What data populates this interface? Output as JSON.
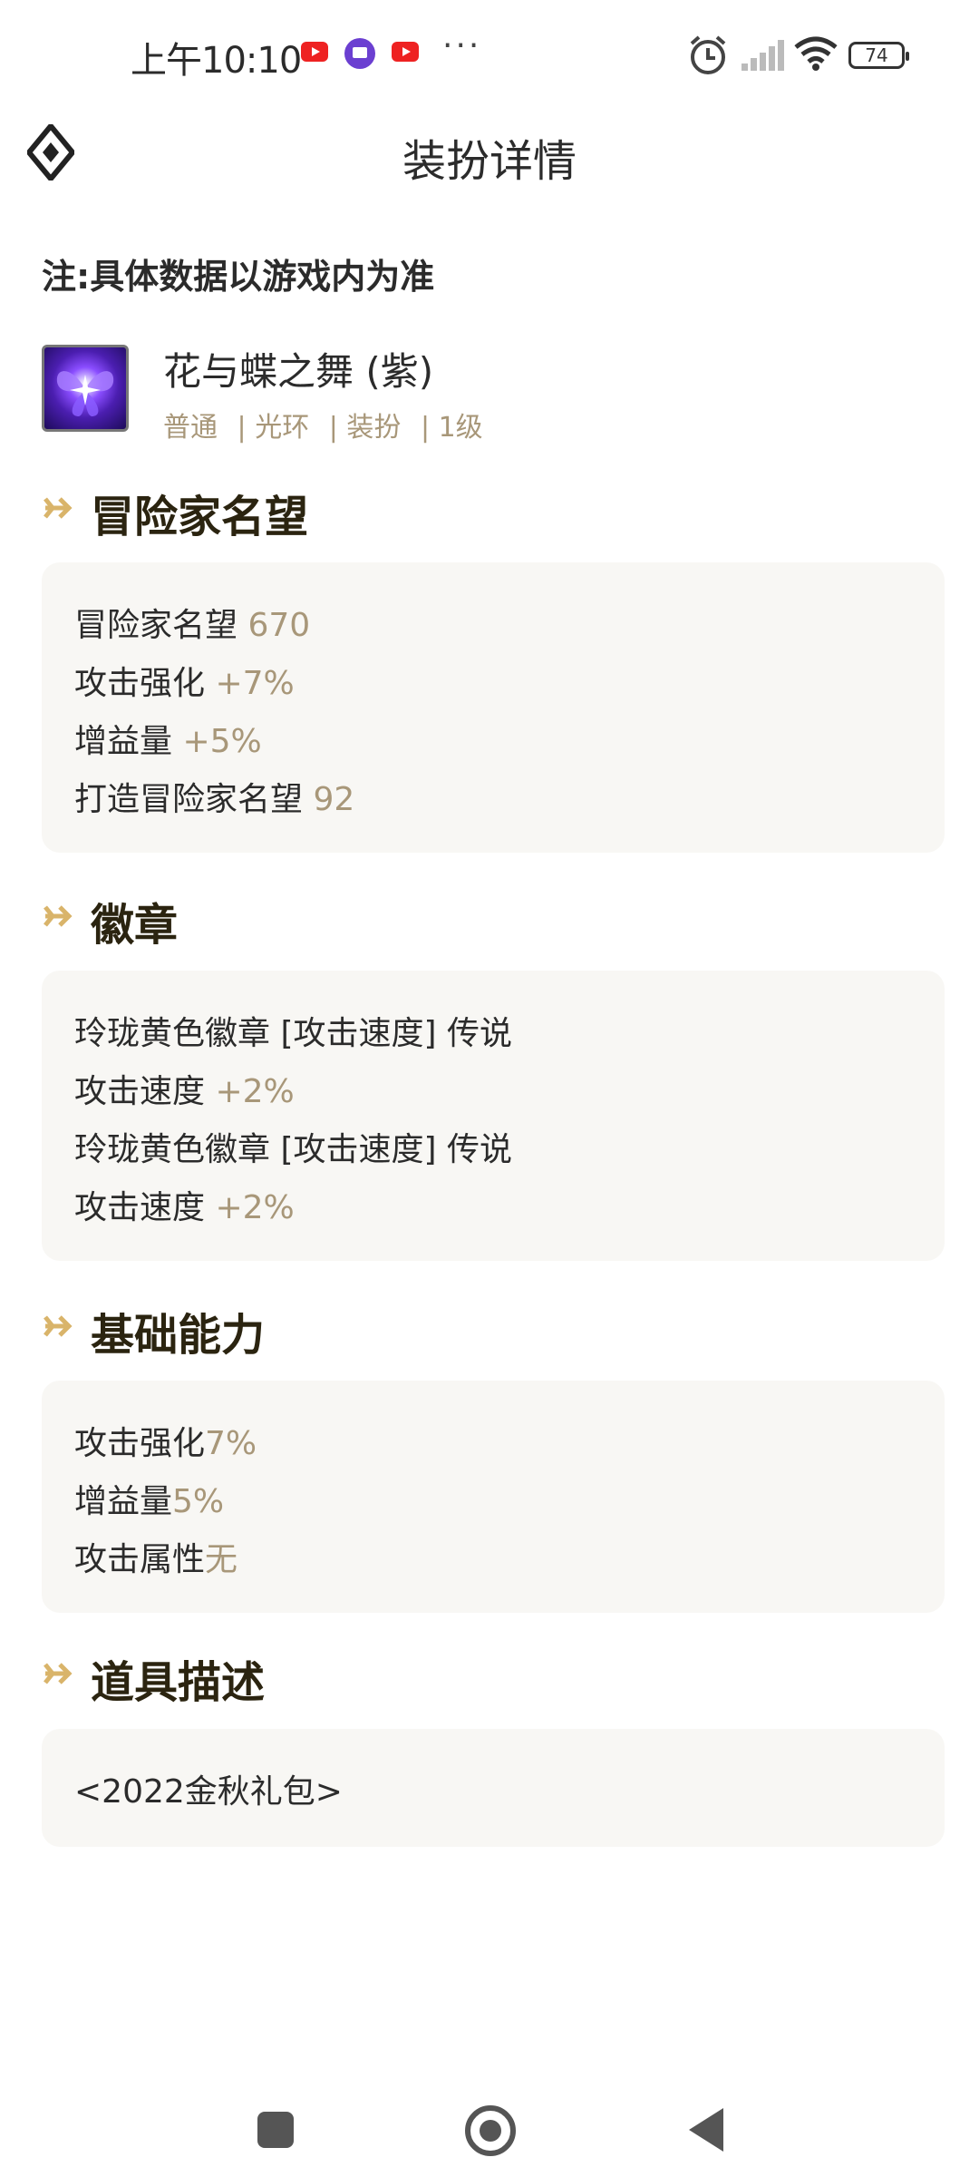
{
  "status_bar": {
    "time": "上午10:10",
    "battery": "74"
  },
  "header": {
    "title": "装扮详情"
  },
  "note": "注:具体数据以游戏内为准",
  "item": {
    "name": "花与蝶之舞 (紫)",
    "tags": [
      "普通",
      "| 光环",
      "| 装扮",
      "| 1级"
    ]
  },
  "sections": {
    "fame": {
      "title": "冒险家名望",
      "lines": [
        {
          "label": "冒险家名望",
          "value": "670"
        },
        {
          "label": "攻击强化",
          "value": "+7%"
        },
        {
          "label": "增益量",
          "value": "+5%"
        },
        {
          "label": "打造冒险家名望",
          "value": "92"
        }
      ]
    },
    "emblem": {
      "title": "徽章",
      "lines": [
        {
          "label": "玲珑黄色徽章 [攻击速度] 传说",
          "value": ""
        },
        {
          "label": "攻击速度",
          "value": "+2%"
        },
        {
          "label": "玲珑黄色徽章 [攻击速度] 传说",
          "value": ""
        },
        {
          "label": "攻击速度",
          "value": "+2%"
        }
      ]
    },
    "basic": {
      "title": "基础能力",
      "lines": [
        {
          "label": "攻击强化",
          "value": "7%"
        },
        {
          "label": "增益量",
          "value": "5%"
        },
        {
          "label": "攻击属性",
          "value": "无"
        }
      ]
    },
    "desc": {
      "title": "道具描述",
      "lines": [
        {
          "label": "<2022金秋礼包>",
          "value": ""
        }
      ]
    }
  }
}
